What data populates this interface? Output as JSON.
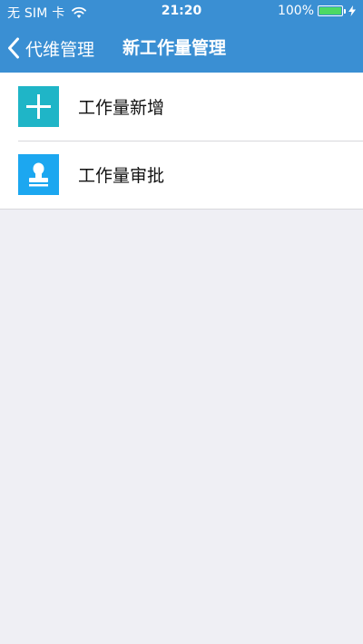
{
  "status_bar": {
    "carrier": "无 SIM 卡",
    "time": "21:20",
    "battery_percent": "100%",
    "battery_level": 1.0,
    "battery_color": "#4cd964"
  },
  "nav": {
    "back_label": "代维管理",
    "title": "新工作量管理",
    "bar_color": "#3a8fd3"
  },
  "menu": {
    "items": [
      {
        "label": "工作量新增",
        "icon": "plus-icon",
        "icon_color": "#1fb5c7"
      },
      {
        "label": "工作量审批",
        "icon": "stamp-icon",
        "icon_color": "#1ca7f0"
      }
    ]
  },
  "background_color": "#efeff4"
}
